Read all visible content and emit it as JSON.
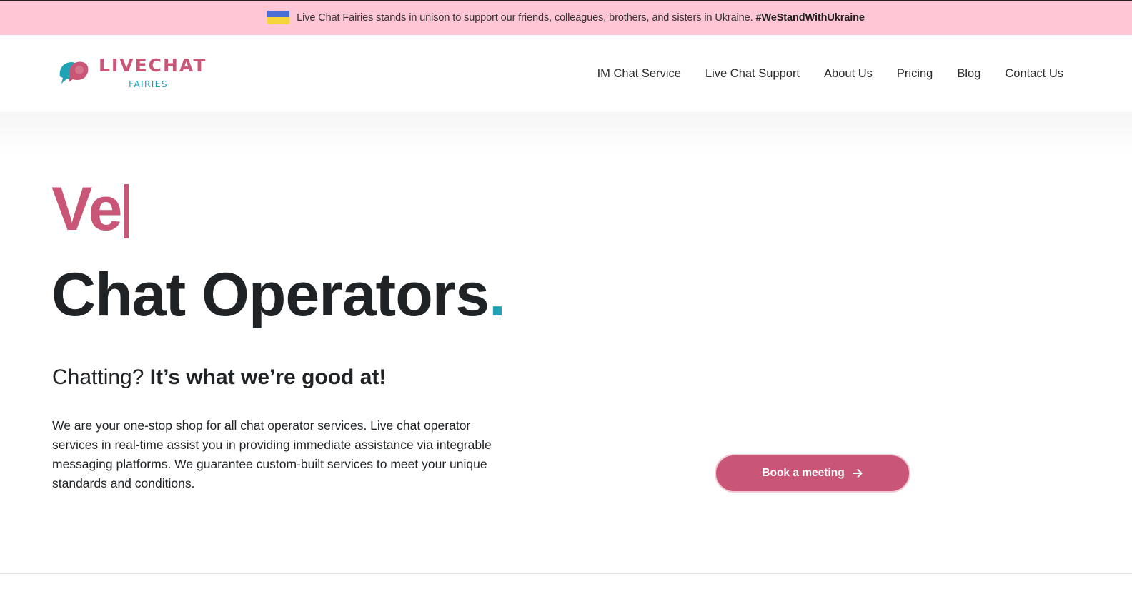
{
  "banner": {
    "flag_icon": "ukraine-flag-icon",
    "text": "Live Chat Fairies stands in unison to support our friends, colleagues, brothers, and sisters in Ukraine.",
    "hashtag": "#WeStandWithUkraine"
  },
  "logo": {
    "name": "LIVECHAT",
    "sub": "FAIRIES",
    "colors": {
      "pink": "#c95677",
      "teal": "#1fa3b5"
    }
  },
  "nav": {
    "items": [
      {
        "label": "IM Chat Service"
      },
      {
        "label": "Live Chat Support"
      },
      {
        "label": "About Us"
      },
      {
        "label": "Pricing"
      },
      {
        "label": "Blog"
      },
      {
        "label": "Contact Us"
      }
    ]
  },
  "hero": {
    "typed_text": "Ve",
    "headline": "Chat Operators",
    "headline_dot": ".",
    "tagline_light": "Chatting?",
    "tagline_strong": "It’s what we’re good at!",
    "body": "We are your one-stop shop for all chat operator services. Live chat operator services in real-time assist you in providing immediate assistance via integrable messaging platforms. We guarantee custom-built services to meet your unique standards and conditions.",
    "cta_label": "Book a meeting",
    "cta_icon": "arrow-right-icon"
  },
  "colors": {
    "accent": "#c95677",
    "teal": "#1fa3b5",
    "banner_bg": "#ffc6d5",
    "dark_text": "#1f2326"
  }
}
